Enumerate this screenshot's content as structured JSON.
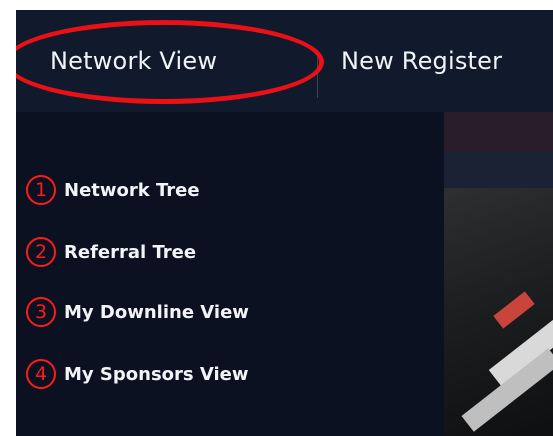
{
  "nav": {
    "items": [
      {
        "label": "Network View"
      },
      {
        "label": "New Register"
      }
    ]
  },
  "dropdown": {
    "items": [
      {
        "number": "1",
        "label": "Network Tree"
      },
      {
        "number": "2",
        "label": "Referral Tree"
      },
      {
        "number": "3",
        "label": "My Downline View"
      },
      {
        "number": "4",
        "label": "My Sponsors View"
      }
    ]
  },
  "annotation": {
    "ellipse_color": "#ea1016",
    "number_color": "#ff1a1a"
  },
  "colors": {
    "topbar": "#111a2c",
    "menu_bg": "#0b1120",
    "text": "#f1f3f7"
  }
}
